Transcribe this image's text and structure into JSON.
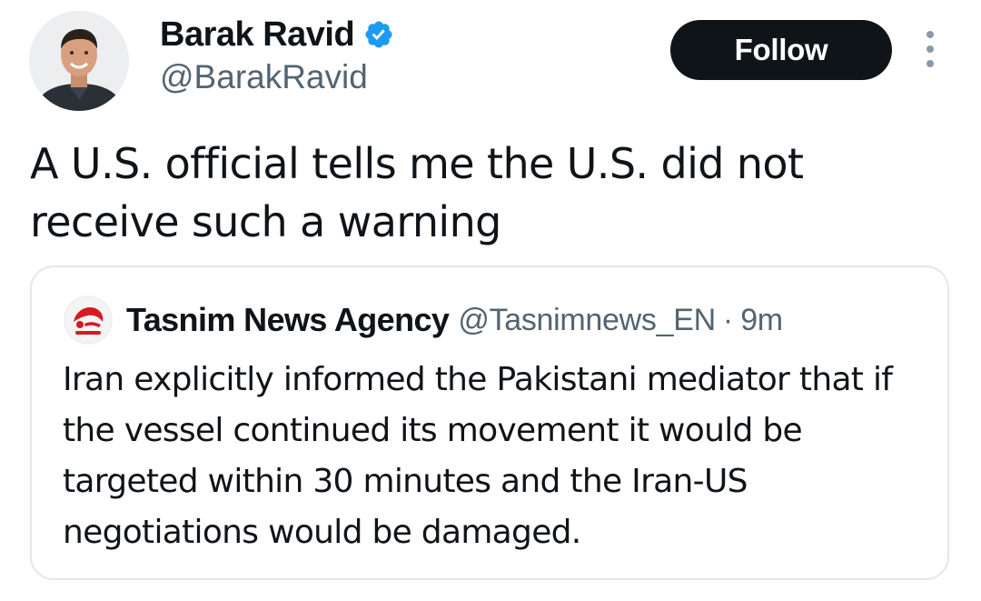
{
  "author": {
    "display_name": "Barak Ravid",
    "handle": "@BarakRavid",
    "verified": true,
    "verified_color": "#1d9bf0",
    "avatar_icon": "profile-photo"
  },
  "actions": {
    "follow_label": "Follow",
    "more_icon": "more-dots-icon"
  },
  "tweet": {
    "text": "A U.S. official tells me the U.S. did not receive such a warning"
  },
  "quoted_tweet": {
    "display_name": "Tasnim News Agency",
    "handle": "@Tasnimnews_EN",
    "separator": "·",
    "time": "9m",
    "avatar_icon": "tasnim-logo",
    "brand_color": "#d71920",
    "text": "Iran explicitly informed the Pakistani mediator that if the vessel continued its movement it would be targeted within 30 minutes and the Iran-US negotiations would be damaged."
  }
}
